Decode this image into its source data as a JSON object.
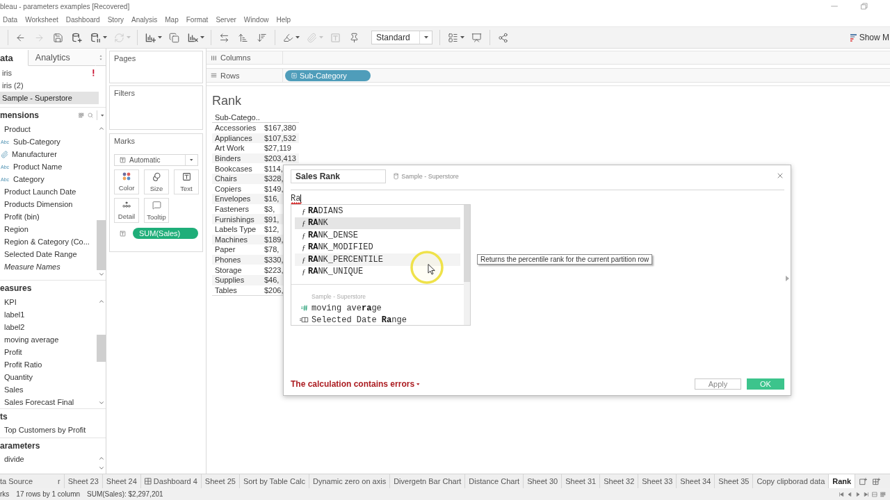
{
  "window": {
    "title": "bleau - parameters examples [Recovered]"
  },
  "menu": [
    "Data",
    "Worksheet",
    "Dashboard",
    "Story",
    "Analysis",
    "Map",
    "Format",
    "Server",
    "Window",
    "Help"
  ],
  "toolbar": {
    "groups": [
      [
        {
          "kind": "back",
          "disabled": false,
          "menu": false
        },
        {
          "kind": "forward",
          "disabled": true,
          "menu": false
        },
        {
          "kind": "save",
          "disabled": false,
          "menu": false
        },
        {
          "kind": "new-source",
          "disabled": false,
          "menu": false
        },
        {
          "kind": "pause",
          "disabled": false,
          "menu": true
        },
        {
          "kind": "refresh",
          "disabled": true,
          "menu": true
        }
      ],
      [
        {
          "kind": "new-sheet",
          "disabled": false,
          "menu": true
        },
        {
          "kind": "duplicate",
          "disabled": false,
          "menu": false
        },
        {
          "kind": "clear",
          "disabled": false,
          "menu": true
        }
      ],
      [
        {
          "kind": "swap",
          "disabled": false,
          "menu": false
        },
        {
          "kind": "sort-asc",
          "disabled": false,
          "menu": false
        },
        {
          "kind": "sort-desc",
          "disabled": false,
          "menu": false
        }
      ],
      [
        {
          "kind": "highlight",
          "disabled": false,
          "menu": true
        },
        {
          "kind": "group",
          "disabled": true,
          "menu": true
        },
        {
          "kind": "labels",
          "disabled": true,
          "menu": false
        },
        {
          "kind": "pin",
          "disabled": false,
          "menu": false
        },
        {
          "kind": "select",
          "value": "Standard"
        }
      ],
      [
        {
          "kind": "cards",
          "disabled": false,
          "menu": true
        },
        {
          "kind": "present",
          "disabled": false,
          "menu": false
        }
      ],
      [
        {
          "kind": "share",
          "disabled": false,
          "menu": false
        }
      ]
    ],
    "show_me": "Show M"
  },
  "data_pane": {
    "tabs": [
      {
        "label": "ata",
        "selected": true
      },
      {
        "label": "Analytics",
        "selected": false
      }
    ],
    "sources": [
      {
        "label": "iris",
        "warning": true,
        "selected": false
      },
      {
        "label": "iris (2)",
        "warning": false,
        "selected": false
      },
      {
        "label": "Sample - Superstore",
        "warning": false,
        "selected": true
      }
    ],
    "sections": [
      {
        "title": "mensions",
        "kind": "dimensions",
        "items": [
          {
            "label": "Product",
            "kind": "hierarchy",
            "children": [
              {
                "label": "Sub-Category",
                "kind": "string",
                "badge": "Abc"
              },
              {
                "label": "Manufacturer",
                "kind": "group"
              },
              {
                "label": "Product Name",
                "kind": "string",
                "badge": "Abc"
              },
              {
                "label": "Category",
                "kind": "string",
                "badge": "Abc"
              }
            ]
          },
          {
            "label": "Product Launch Date",
            "kind": "field"
          },
          {
            "label": "Products Dimension",
            "kind": "field"
          },
          {
            "label": "Profit (bin)",
            "kind": "field"
          },
          {
            "label": "Region",
            "kind": "field"
          },
          {
            "label": "Region & Category (Co...",
            "kind": "field"
          },
          {
            "label": "Selected Date Range",
            "kind": "field"
          },
          {
            "label": "Measure Names",
            "kind": "generated"
          }
        ]
      },
      {
        "title": "easures",
        "kind": "measures",
        "items": [
          {
            "label": "KPI",
            "kind": "field"
          },
          {
            "label": "label1",
            "kind": "field"
          },
          {
            "label": "label2",
            "kind": "field"
          },
          {
            "label": "moving average",
            "kind": "field"
          },
          {
            "label": "Profit",
            "kind": "field"
          },
          {
            "label": "Profit Ratio",
            "kind": "field"
          },
          {
            "label": "Quantity",
            "kind": "field"
          },
          {
            "label": "Sales",
            "kind": "field"
          },
          {
            "label": "Sales Forecast Final",
            "kind": "field"
          }
        ]
      },
      {
        "title": "ts",
        "kind": "sets",
        "items": [
          {
            "label": "Top Customers by Profit",
            "kind": "field"
          }
        ]
      },
      {
        "title": "arameters",
        "kind": "parameters",
        "items": [
          {
            "label": "divide",
            "kind": "field"
          }
        ]
      }
    ]
  },
  "shelves_pane": {
    "pages": "Pages",
    "filters": "Filters",
    "marks": {
      "title": "Marks",
      "mark_type": "Automatic",
      "buttons": [
        {
          "label": "Color",
          "kind": "color"
        },
        {
          "label": "Size",
          "kind": "size"
        },
        {
          "label": "Text",
          "kind": "text"
        },
        {
          "label": "Detail",
          "kind": "detail"
        },
        {
          "label": "Tooltip",
          "kind": "tooltip"
        }
      ],
      "pills": [
        {
          "label": "SUM(Sales)",
          "kind": "text"
        }
      ]
    }
  },
  "shelves": {
    "columns": {
      "label": "Columns"
    },
    "rows": {
      "label": "Rows",
      "pills": [
        "Sub-Category"
      ]
    }
  },
  "view": {
    "title": "Rank",
    "table": {
      "columns": [
        "Sub-Catego.."
      ],
      "rows": [
        [
          "Accessories",
          "$167,380"
        ],
        [
          "Appliances",
          "$107,532"
        ],
        [
          "Art Work",
          "$27,119"
        ],
        [
          "Binders",
          "$203,413"
        ],
        [
          "Bookcases",
          "$114,"
        ],
        [
          "Chairs",
          "$328,"
        ],
        [
          "Copiers",
          "$149,"
        ],
        [
          "Envelopes",
          "$16,"
        ],
        [
          "Fasteners",
          "$3,"
        ],
        [
          "Furnishings",
          "$91,"
        ],
        [
          "Labels Type",
          "$12,"
        ],
        [
          "Machines",
          "$189,"
        ],
        [
          "Paper",
          "$78,"
        ],
        [
          "Phones",
          "$330,"
        ],
        [
          "Storage",
          "$223,"
        ],
        [
          "Supplies",
          "$46,"
        ],
        [
          "Tables",
          "$206,"
        ]
      ]
    }
  },
  "calc_dialog": {
    "name": "Sales Rank",
    "source": "Sample - Superstore",
    "formula": {
      "text": "Ra",
      "invalid": true
    },
    "autocomplete": {
      "functions": [
        {
          "symbol": "ƒ",
          "label": "**RA**DIANS",
          "selected": false,
          "hovered": false
        },
        {
          "symbol": "ƒ",
          "label": "**RA**NK",
          "selected": true,
          "hovered": false
        },
        {
          "symbol": "ƒ",
          "label": "**RA**NK_DENSE",
          "selected": false,
          "hovered": false
        },
        {
          "symbol": "ƒ",
          "label": "**RA**NK_MODIFIED",
          "selected": false,
          "hovered": false
        },
        {
          "symbol": "ƒ",
          "label": "**RA**NK_PERCENTILE",
          "selected": false,
          "hovered": true
        },
        {
          "symbol": "ƒ",
          "label": "**RA**NK_UNIQUE",
          "selected": false,
          "hovered": false
        }
      ],
      "source_title": "Sample - Superstore",
      "fields": [
        {
          "label": "moving ave**ra**ge",
          "kind": "measure",
          "selected": false
        },
        {
          "label": "Selected Date **Ra**nge",
          "kind": "parameter",
          "selected": false
        }
      ]
    },
    "tooltip": "Returns the percentile rank for the current partition row",
    "error": "The calculation contains errors",
    "buttons": [
      {
        "label": "Apply",
        "kind": "secondary"
      },
      {
        "label": "OK",
        "kind": "primary"
      }
    ]
  },
  "sheet_tabs": {
    "data_source": "ta Source",
    "tabs": [
      {
        "label": "r",
        "kind": "sheet",
        "selected": false
      },
      {
        "label": "Sheet 23",
        "kind": "sheet",
        "selected": false
      },
      {
        "label": "Sheet 24",
        "kind": "sheet",
        "selected": false
      },
      {
        "label": "Dashboard 4",
        "kind": "dashboard",
        "selected": false
      },
      {
        "label": "Sheet 25",
        "kind": "sheet",
        "selected": false
      },
      {
        "label": "Sort by Table Calc",
        "kind": "sheet",
        "selected": false
      },
      {
        "label": "Dynamic zero on axis",
        "kind": "sheet",
        "selected": false
      },
      {
        "label": "Divergetn Bar Chart",
        "kind": "sheet",
        "selected": false
      },
      {
        "label": "Distance Chart",
        "kind": "sheet",
        "selected": false
      },
      {
        "label": "Sheet 30",
        "kind": "sheet",
        "selected": false
      },
      {
        "label": "Sheet 31",
        "kind": "sheet",
        "selected": false
      },
      {
        "label": "Sheet 32",
        "kind": "sheet",
        "selected": false
      },
      {
        "label": "Sheet 33",
        "kind": "sheet",
        "selected": false
      },
      {
        "label": "Sheet 34",
        "kind": "sheet",
        "selected": false
      },
      {
        "label": "Sheet 35",
        "kind": "sheet",
        "selected": false
      },
      {
        "label": "Copy clipborad data",
        "kind": "sheet",
        "selected": false
      },
      {
        "label": "Rank",
        "kind": "sheet",
        "selected": true
      }
    ]
  },
  "status_bar": [
    "rks",
    "17 rows by 1 column",
    "SUM(Sales): $2,297,201"
  ]
}
